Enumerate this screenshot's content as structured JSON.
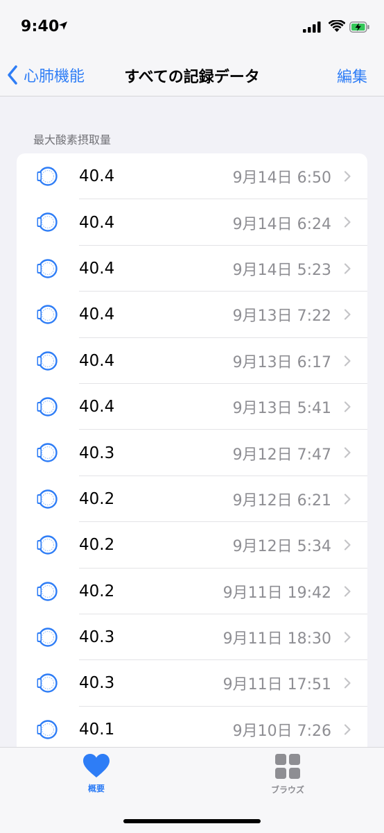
{
  "status_bar": {
    "time": "9:40"
  },
  "nav": {
    "back_label": "心肺機能",
    "title": "すべての記録データ",
    "edit_label": "編集"
  },
  "section": {
    "header": "最大酸素摂取量"
  },
  "records": [
    {
      "value": "40.4",
      "date": "9月14日 6:50"
    },
    {
      "value": "40.4",
      "date": "9月14日 6:24"
    },
    {
      "value": "40.4",
      "date": "9月14日 5:23"
    },
    {
      "value": "40.4",
      "date": "9月13日 7:22"
    },
    {
      "value": "40.4",
      "date": "9月13日 6:17"
    },
    {
      "value": "40.4",
      "date": "9月13日 5:41"
    },
    {
      "value": "40.3",
      "date": "9月12日 7:47"
    },
    {
      "value": "40.2",
      "date": "9月12日 6:21"
    },
    {
      "value": "40.2",
      "date": "9月12日 5:34"
    },
    {
      "value": "40.2",
      "date": "9月11日 19:42"
    },
    {
      "value": "40.3",
      "date": "9月11日 18:30"
    },
    {
      "value": "40.3",
      "date": "9月11日 17:51"
    },
    {
      "value": "40.1",
      "date": "9月10日 7:26"
    }
  ],
  "tabs": {
    "summary_label": "概要",
    "browse_label": "ブラウズ"
  },
  "colors": {
    "accent": "#2e7df6",
    "secondary_text": "#8e8e93",
    "background": "#f2f2f7"
  },
  "icons": {
    "row_icon": "apple-watch-icon",
    "summary_tab": "heart-icon",
    "browse_tab": "grid-icon"
  }
}
